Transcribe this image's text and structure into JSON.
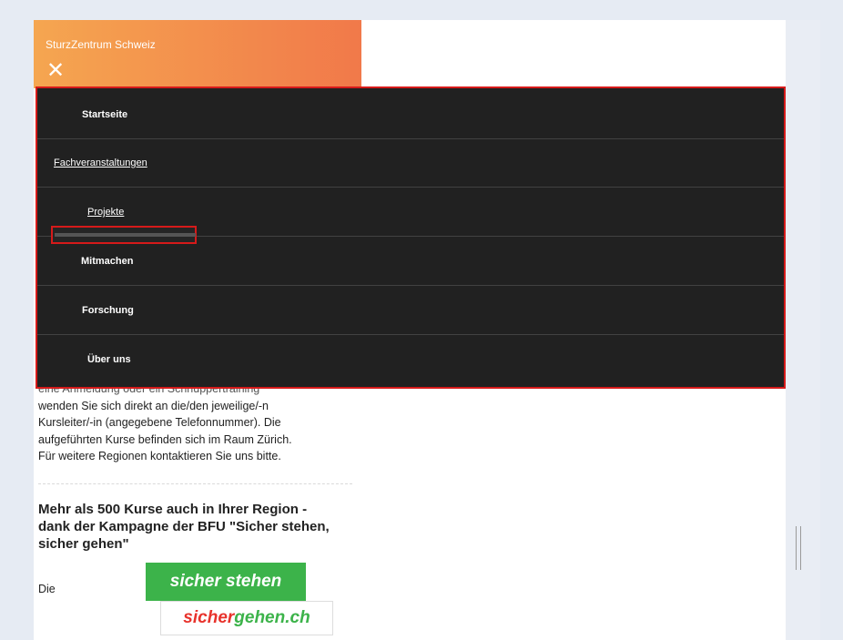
{
  "header": {
    "site_title": "SturzZentrum Schweiz"
  },
  "menu": {
    "items": [
      {
        "label": "Startseite"
      },
      {
        "label": "Fachveranstaltungen"
      },
      {
        "label": "Projekte"
      },
      {
        "label": "Mitmachen"
      },
      {
        "label": "Forschung"
      },
      {
        "label": "Über uns"
      }
    ]
  },
  "content": {
    "paragraph_lines": [
      "eine Anmeldung oder ein Schnuppertraining",
      "wenden Sie sich direkt an die/den jeweilige/-n",
      "Kursleiter/-in (angegebene Telefonnummer). Die",
      "aufgeführten Kurse befinden sich im Raum Zürich.",
      "Für weitere Regionen kontaktieren Sie uns bitte."
    ],
    "headline": "Mehr als 500 Kurse auch in Ihrer Region - dank der Kampagne der BFU \"Sicher stehen, sicher gehen\"",
    "die_text": "Die",
    "badge_top": "sicher stehen",
    "badge_bottom_part1": "sicher",
    "badge_bottom_part2": "gehen.ch"
  }
}
